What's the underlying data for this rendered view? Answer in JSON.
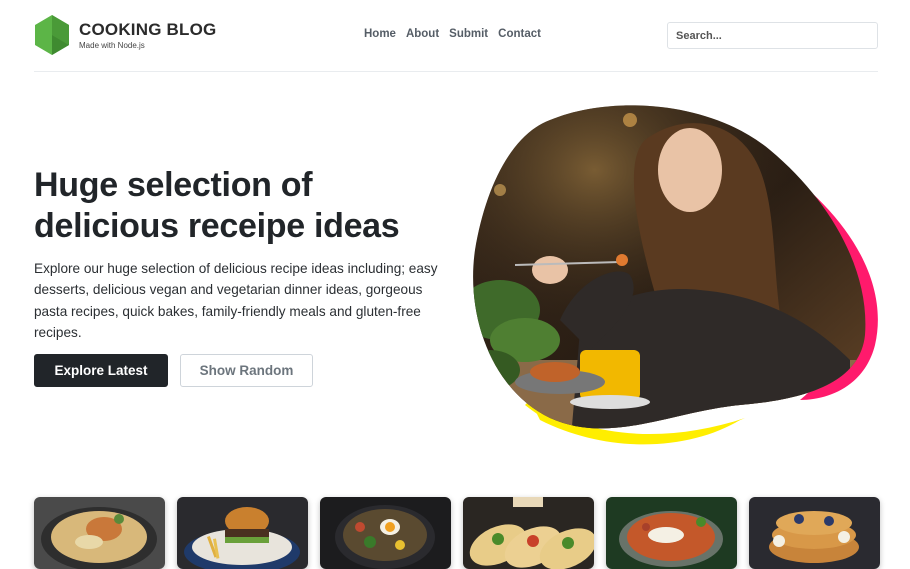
{
  "brand": {
    "title": "COOKING BLOG",
    "subtitle": "Made with Node.js",
    "logo_icon": "green-hexagon-logo-icon"
  },
  "nav": {
    "items": [
      "Home",
      "About",
      "Submit",
      "Contact"
    ]
  },
  "search": {
    "placeholder": "Search..."
  },
  "hero": {
    "title": "Huge selection of delicious receipe ideas",
    "description": "Explore our huge selection of delicious recipe ideas including; easy desserts, delicious vegan and vegetarian dinner ideas, gorgeous pasta recipes, quick bakes, family-friendly meals and gluten-free recipes.",
    "primary_button": "Explore Latest",
    "secondary_button": "Show Random",
    "image": "woman-eating-image"
  },
  "thumbnails": [
    {
      "image": "pasta-dish-image"
    },
    {
      "image": "burger-fries-image"
    },
    {
      "image": "ramen-bowl-image"
    },
    {
      "image": "tacos-image"
    },
    {
      "image": "curry-bowl-image"
    },
    {
      "image": "pancakes-berries-image"
    }
  ],
  "colors": {
    "accent_dark": "#212529",
    "logo_green": "#5cb547",
    "blob_pink": "#ff1a6c",
    "blob_yellow": "#ffee00"
  }
}
